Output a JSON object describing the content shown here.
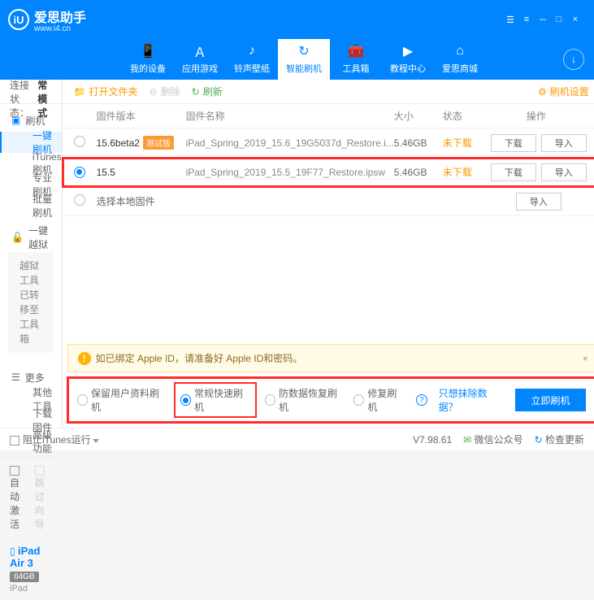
{
  "brand": {
    "name": "爱思助手",
    "url": "www.i4.cn",
    "logo": "iU"
  },
  "window": {
    "controls": [
      "☰",
      "≡",
      "－",
      "□",
      "×"
    ]
  },
  "nav": {
    "items": [
      {
        "icon": "📱",
        "label": "我的设备"
      },
      {
        "icon": "Ａ",
        "label": "应用游戏"
      },
      {
        "icon": "♪",
        "label": "铃声壁纸"
      },
      {
        "icon": "↻",
        "label": "智能刷机"
      },
      {
        "icon": "🧰",
        "label": "工具箱"
      },
      {
        "icon": "▶",
        "label": "教程中心"
      },
      {
        "icon": "⌂",
        "label": "爱思商城"
      }
    ],
    "activeIndex": 3,
    "rightIcon": "↓"
  },
  "sidebar": {
    "statusLabel": "设备连接状态：",
    "statusValue": "正常模式",
    "group1": {
      "head": "刷机",
      "items": [
        "一键刷机",
        "iTunes刷机",
        "专业刷机",
        "批量刷机"
      ],
      "activeIndex": 0
    },
    "group2": {
      "head": "一键越狱",
      "note": "越狱工具已转移至工具箱"
    },
    "group3": {
      "head": "更多",
      "items": [
        "其他工具",
        "下载固件",
        "高级功能"
      ]
    },
    "bottom": {
      "autoActivate": "自动激活",
      "skipGuide": "跳过向导"
    },
    "device": {
      "name": "iPad Air 3",
      "storage": "64GB",
      "model": "iPad"
    }
  },
  "toolbar": {
    "openFolder": "打开文件夹",
    "delete": "删除",
    "refresh": "刷新",
    "settings": "刷机设置"
  },
  "table": {
    "headers": {
      "version": "固件版本",
      "name": "固件名称",
      "size": "大小",
      "status": "状态",
      "ops": "操作"
    },
    "rows": [
      {
        "version": "15.6beta2",
        "beta": "测试版",
        "name": "iPad_Spring_2019_15.6_19G5037d_Restore.i...",
        "size": "5.46GB",
        "status": "未下载",
        "selected": false
      },
      {
        "version": "15.5",
        "beta": "",
        "name": "iPad_Spring_2019_15.5_19F77_Restore.ipsw",
        "size": "5.46GB",
        "status": "未下载",
        "selected": true
      }
    ],
    "local": "选择本地固件",
    "download": "下载",
    "import": "导入"
  },
  "warning": {
    "icon": "!",
    "text": "如已绑定 Apple ID，请准备好 Apple ID和密码。"
  },
  "modes": {
    "items": [
      "保留用户资料刷机",
      "常规快速刷机",
      "防数据恢复刷机",
      "修复刷机"
    ],
    "selectedIndex": 1,
    "exclude": "只想抹除数据？",
    "flash": "立即刷机"
  },
  "footer": {
    "blockItunes": "阻止iTunes运行",
    "version": "V7.98.61",
    "wechat": "微信公众号",
    "update": "检查更新"
  }
}
